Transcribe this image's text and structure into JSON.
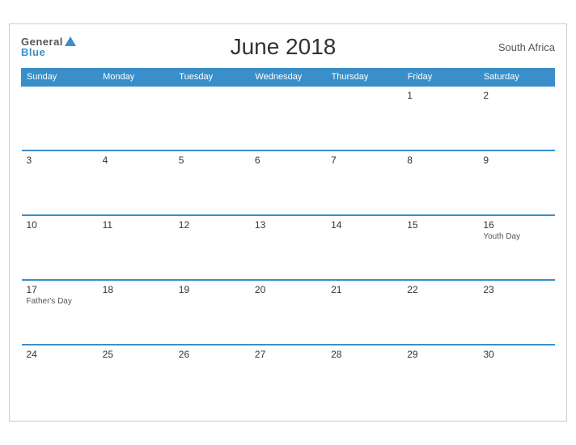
{
  "header": {
    "logo_general": "General",
    "logo_blue": "Blue",
    "title": "June 2018",
    "country": "South Africa"
  },
  "weekdays": [
    "Sunday",
    "Monday",
    "Tuesday",
    "Wednesday",
    "Thursday",
    "Friday",
    "Saturday"
  ],
  "weeks": [
    [
      {
        "day": "",
        "event": ""
      },
      {
        "day": "",
        "event": ""
      },
      {
        "day": "",
        "event": ""
      },
      {
        "day": "",
        "event": ""
      },
      {
        "day": "",
        "event": ""
      },
      {
        "day": "1",
        "event": ""
      },
      {
        "day": "2",
        "event": ""
      }
    ],
    [
      {
        "day": "3",
        "event": ""
      },
      {
        "day": "4",
        "event": ""
      },
      {
        "day": "5",
        "event": ""
      },
      {
        "day": "6",
        "event": ""
      },
      {
        "day": "7",
        "event": ""
      },
      {
        "day": "8",
        "event": ""
      },
      {
        "day": "9",
        "event": ""
      }
    ],
    [
      {
        "day": "10",
        "event": ""
      },
      {
        "day": "11",
        "event": ""
      },
      {
        "day": "12",
        "event": ""
      },
      {
        "day": "13",
        "event": ""
      },
      {
        "day": "14",
        "event": ""
      },
      {
        "day": "15",
        "event": ""
      },
      {
        "day": "16",
        "event": "Youth Day"
      }
    ],
    [
      {
        "day": "17",
        "event": "Father's Day"
      },
      {
        "day": "18",
        "event": ""
      },
      {
        "day": "19",
        "event": ""
      },
      {
        "day": "20",
        "event": ""
      },
      {
        "day": "21",
        "event": ""
      },
      {
        "day": "22",
        "event": ""
      },
      {
        "day": "23",
        "event": ""
      }
    ],
    [
      {
        "day": "24",
        "event": ""
      },
      {
        "day": "25",
        "event": ""
      },
      {
        "day": "26",
        "event": ""
      },
      {
        "day": "27",
        "event": ""
      },
      {
        "day": "28",
        "event": ""
      },
      {
        "day": "29",
        "event": ""
      },
      {
        "day": "30",
        "event": ""
      }
    ]
  ]
}
